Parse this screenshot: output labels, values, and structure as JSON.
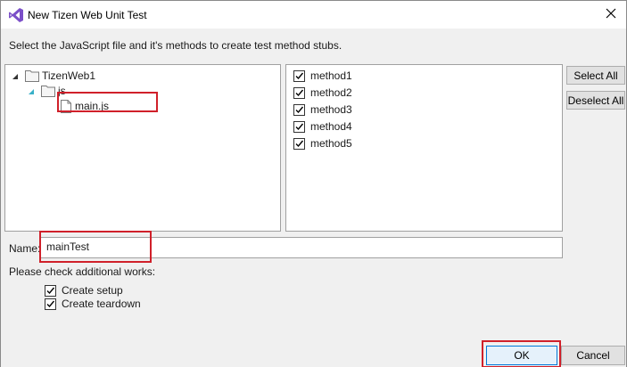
{
  "window": {
    "title": "New Tizen Web Unit Test",
    "close_icon": "close-icon",
    "app_icon": "visual-studio-icon"
  },
  "instruction": "Select the JavaScript file and it's methods to create test method stubs.",
  "file_tree": {
    "root": {
      "label": "TizenWeb1",
      "expanded": true
    },
    "folder": {
      "label": "js",
      "expanded": true
    },
    "file": {
      "label": "main.js",
      "selected": true
    }
  },
  "methods": [
    {
      "label": "method1",
      "checked": true
    },
    {
      "label": "method2",
      "checked": true
    },
    {
      "label": "method3",
      "checked": true
    },
    {
      "label": "method4",
      "checked": true
    },
    {
      "label": "method5",
      "checked": true
    }
  ],
  "buttons": {
    "select_all": "Select All",
    "deselect_all": "Deselect All",
    "ok": "OK",
    "cancel": "Cancel"
  },
  "name_field": {
    "label": "Name:",
    "value": "mainTest"
  },
  "additional": {
    "label": "Please check additional works:",
    "options": [
      {
        "label": "Create setup",
        "checked": true
      },
      {
        "label": "Create teardown",
        "checked": true
      }
    ]
  },
  "colors": {
    "highlight": "#d0202a",
    "accent": "#0078d7",
    "tree_arrow": "#38b0c8"
  }
}
